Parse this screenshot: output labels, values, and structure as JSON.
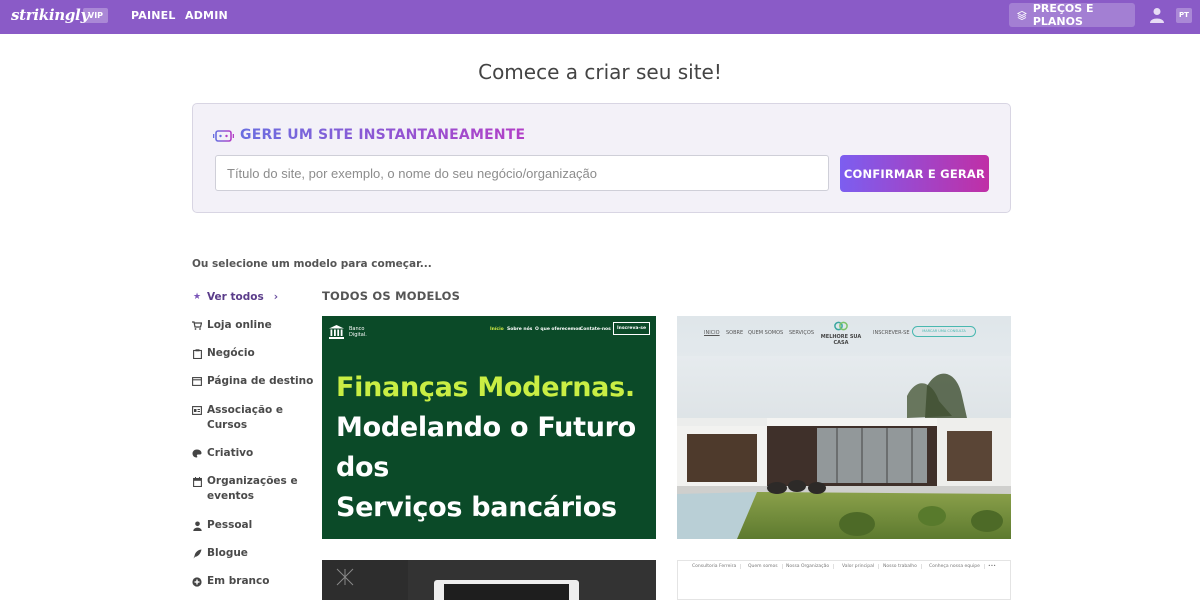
{
  "topbar": {
    "logo": "strikingly",
    "badge": "VIP",
    "nav": [
      "PAINEL",
      "ADMIN"
    ],
    "pricing": "PREÇOS E PLANOS",
    "language": "PT"
  },
  "heading": "Comece a criar seu site!",
  "generator": {
    "title": "GERE UM SITE INSTANTANEAMENTE",
    "placeholder": "Título do site, por exemplo, o nome do seu negócio/organização",
    "value": "",
    "button": "CONFIRMAR E GERAR"
  },
  "select_label": "Ou selecione um modelo para começar...",
  "sidebar": {
    "items": [
      {
        "label": "Ver todos",
        "icon": "star-icon",
        "active": true
      },
      {
        "label": "Loja online",
        "icon": "cart-icon"
      },
      {
        "label": "Negócio",
        "icon": "clipboard-icon"
      },
      {
        "label": "Página de destino",
        "icon": "window-icon"
      },
      {
        "label": "Associação e",
        "label2": "Cursos",
        "icon": "id-card-icon"
      },
      {
        "label": "Criativo",
        "icon": "palette-icon"
      },
      {
        "label": "Organizações e",
        "label2": "eventos",
        "icon": "calendar-icon"
      },
      {
        "label": "Pessoal",
        "icon": "person-icon"
      },
      {
        "label": "Blogue",
        "icon": "feather-icon"
      },
      {
        "label": "Em branco",
        "icon": "plus-circle-icon"
      }
    ]
  },
  "models_title": "TODOS OS MODELOS",
  "templates": {
    "t1": {
      "logo_line1": "Banco",
      "logo_line2": "Digital.",
      "nav": [
        "Início",
        "Sobre nós",
        "O que oferecemos",
        "Contate-nos"
      ],
      "cta": "Inscreva-se",
      "headline": [
        "Finanças Modernas.",
        "Modelando o Futuro",
        "dos",
        "Serviços bancários"
      ],
      "accent": "#c9ee44",
      "bg": "#0b4a28"
    },
    "t2": {
      "nav": [
        "INICIO",
        "SOBRE",
        "QUEM SOMOS",
        "SERVIÇOS"
      ],
      "logo_line1": "MELHORE SUA",
      "logo_line2": "CASA",
      "nav_right": "INSCREVER-SE",
      "pill": "MARCAR UMA CONSULTA"
    },
    "t4": {
      "nav": [
        "Consultoria Ferreira",
        "Quem somos",
        "Nossa Organização",
        "Valor principal",
        "Nosso trabalho",
        "Conheça nossa equipe",
        "•••"
      ]
    }
  }
}
